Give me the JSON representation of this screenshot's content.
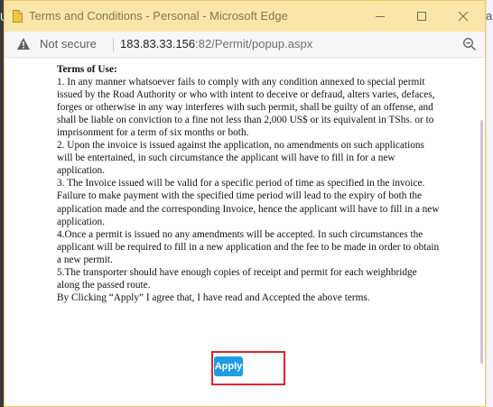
{
  "window": {
    "title": "Terms and Conditions - Personal - Microsoft Edge"
  },
  "address": {
    "security_label": "Not secure",
    "url_host": "183.83.33.156",
    "url_rest": ":82/Permit/popup.aspx"
  },
  "background": {
    "left_letter": "U",
    "right_letter": "a"
  },
  "terms": {
    "heading": "Terms of Use:",
    "paragraphs": [
      "1. In any manner whatsoever fails to comply with any condition annexed to special permit issued by the Road Authority or who with intent to deceive or defraud, alters varies, defaces, forges or otherwise in any way interferes with such permit, shall be guilty of an offense, and shall be liable on conviction to a fine not less than 2,000 US$ or its equivalent in TShs. or to imprisonment for a term of six months or both.",
      "2. Upon the invoice is issued against the application, no amendments on such applications will be entertained, in such circumstance the applicant will have to fill in for a new application.",
      "3. The Invoice issued will be valid for a specific period of time as specified in the invoice. Failure to make payment with the specified time period will lead to the expiry of both the application made and the corresponding Invoice, hence the applicant will have to fill in a new application.",
      "4.Once a permit is issued no any amendments will be accepted. In such circumstances the applicant will be required to fill in a new application and the fee to be made in order to obtain a new permit.",
      "5.The transporter should have enough copies of receipt and permit for each weighbridge along the passed route."
    ],
    "agreement": "By Clicking “Apply” I agree that, I have read and Accepted the above terms."
  },
  "actions": {
    "apply_label": "Apply"
  },
  "colors": {
    "titlebar": "#fbe6a9",
    "apply_button": "#1e9de6",
    "highlight_border": "#e1232a"
  },
  "icons": [
    "page-icon",
    "minimize-icon",
    "maximize-icon",
    "close-icon",
    "warning-icon",
    "zoom-out-icon"
  ]
}
